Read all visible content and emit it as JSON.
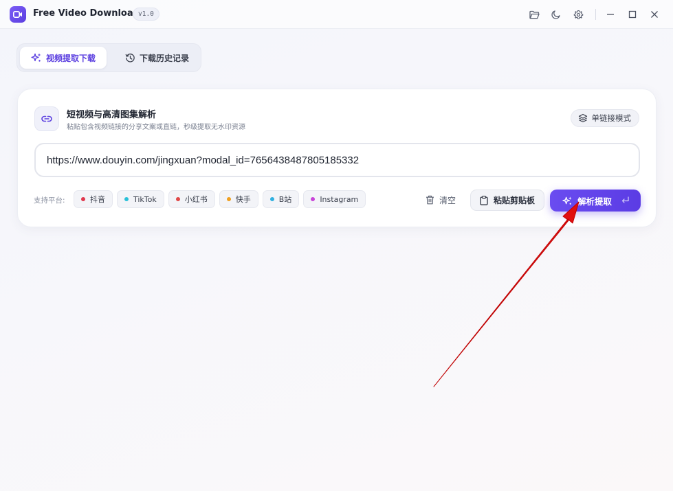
{
  "app": {
    "title": "Free Video Downloader",
    "version": "v1.0",
    "accent": "#5b3fe0"
  },
  "titlebar_icons": [
    "folder-icon",
    "moon-icon",
    "gear-icon",
    "minimize-icon",
    "maximize-icon",
    "close-icon"
  ],
  "tabs": [
    {
      "label": "视频提取下载",
      "icon": "sparkle-icon",
      "active": true
    },
    {
      "label": "下载历史记录",
      "icon": "history-icon",
      "active": false
    }
  ],
  "card": {
    "title": "短视频与高清图集解析",
    "subtitle": "粘贴包含视频链接的分享文案或直链，秒级提取无水印资源",
    "mode_label": "单链接模式"
  },
  "input": {
    "value": "https://www.douyin.com/jingxuan?modal_id=7656438487805185332"
  },
  "platforms": {
    "label": "支持平台:",
    "items": [
      {
        "name": "抖音",
        "color": "#e0384e"
      },
      {
        "name": "TikTok",
        "color": "#28c0d8"
      },
      {
        "name": "小红书",
        "color": "#e04848"
      },
      {
        "name": "快手",
        "color": "#f0a020"
      },
      {
        "name": "B站",
        "color": "#30b0e0"
      },
      {
        "name": "Instagram",
        "color": "#c844d8"
      }
    ]
  },
  "actions": {
    "clear_label": "清空",
    "paste_label": "粘贴剪贴板",
    "extract_label": "解析提取"
  },
  "annotation": {
    "color": "#e01010"
  }
}
